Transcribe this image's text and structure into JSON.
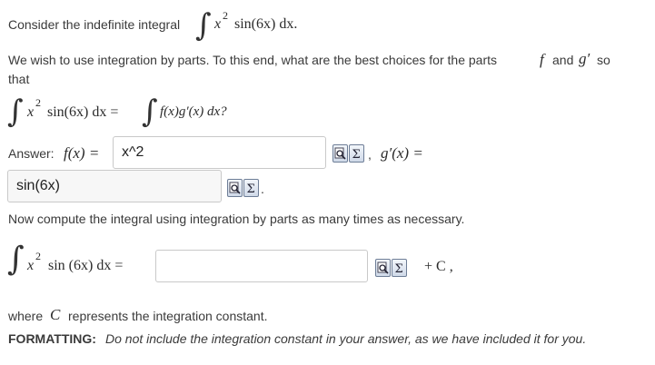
{
  "line1": {
    "text": "Consider the indefinite integral",
    "integrand": "x",
    "power": "2",
    "func": "sin(6x) dx."
  },
  "line2": {
    "text_a": "We wish to use integration by parts.  To this end, what are the best choices for the parts",
    "f": "f",
    "and": "and",
    "g": "g′",
    "so": "so",
    "that": "that"
  },
  "equation": {
    "lhs_x": "x",
    "lhs_power": "2",
    "lhs_rest": "sin(6x) dx =",
    "rhs": "f(x)g′(x) dx?"
  },
  "answer_f": {
    "label": "Answer:",
    "math": "f(x) =",
    "value": "x^2"
  },
  "answer_g": {
    "separator": ",",
    "math": "g′(x) =",
    "value": "sin(6x)",
    "end": "."
  },
  "line_compute": {
    "text": "Now compute the integral using integration by parts as many times as necessary."
  },
  "integral_answer": {
    "x": "x",
    "power": "2",
    "rest": "sin (6x) dx =",
    "value": "",
    "tail": "+ C ,"
  },
  "where": {
    "text_a": "where",
    "c": "C",
    "text_b": "represents the integration constant."
  },
  "formatting": {
    "label": "FORMATTING:",
    "text": "Do not include the integration constant in your answer, as we have included it for you."
  },
  "icons": {
    "preview": "preview-icon",
    "equation": "equation-editor-icon"
  }
}
